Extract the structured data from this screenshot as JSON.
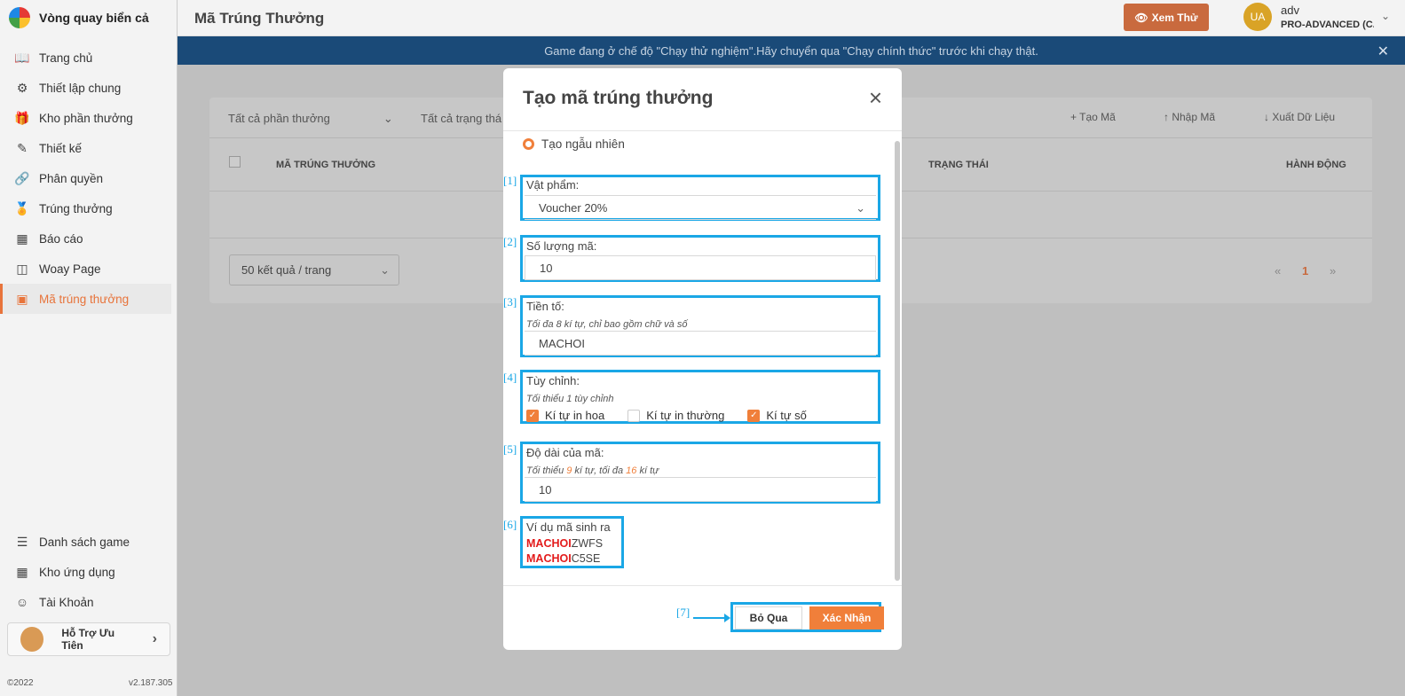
{
  "app": {
    "name": "Vòng quay biển cả"
  },
  "sidebar": {
    "items": [
      {
        "label": "Trang chủ",
        "icon": "book-icon"
      },
      {
        "label": "Thiết lập chung",
        "icon": "gear-icon"
      },
      {
        "label": "Kho phần thưởng",
        "icon": "gift-icon"
      },
      {
        "label": "Thiết kế",
        "icon": "edit-icon"
      },
      {
        "label": "Phân quyền",
        "icon": "link-icon"
      },
      {
        "label": "Trúng thưởng",
        "icon": "award-icon"
      },
      {
        "label": "Báo cáo",
        "icon": "grid-icon"
      },
      {
        "label": "Woay Page",
        "icon": "layout-icon"
      },
      {
        "label": "Mã trúng thưởng",
        "icon": "ticket-icon",
        "active": true
      }
    ],
    "bottom_items": [
      {
        "label": "Danh sách game",
        "icon": "menu-icon"
      },
      {
        "label": "Kho ứng dụng",
        "icon": "apps-icon"
      },
      {
        "label": "Tài Khoản",
        "icon": "user-icon"
      }
    ],
    "support": "Hỗ Trợ Ưu Tiên",
    "copyright": "©2022",
    "version": "v2.187.305"
  },
  "header": {
    "title": "Mã Trúng Thưởng",
    "preview_button": "Xem Thử",
    "user_initials": "UA",
    "user_name": "adv",
    "user_plan": "PRO-ADVANCED (C..."
  },
  "banner": {
    "text": "Game đang ở chế độ \"Chạy thử nghiệm\".Hãy chuyển qua \"Chạy chính thức\" trước khi chạy thật."
  },
  "table": {
    "filter_prize": "Tất cả phần thưởng",
    "filter_status": "Tất cả trạng thá",
    "create_code": "Tạo Mã",
    "import_code": "Nhập Mã",
    "export_data": "Xuất Dữ Liệu",
    "col_code": "MÃ TRÚNG THƯỞNG",
    "col_status": "TRẠNG THÁI",
    "col_action": "HÀNH ĐỘNG",
    "page_size": "50 kết quả / trang",
    "prev": "«",
    "current_page": "1",
    "next": "»"
  },
  "modal": {
    "title": "Tạo mã trúng thưởng",
    "mode_label": "Tạo ngẫu nhiên",
    "item_label": "Vật phẩm:",
    "item_value": "Voucher 20%",
    "quantity_label": "Số lượng mã:",
    "quantity_value": "10",
    "prefix_label": "Tiền tố:",
    "prefix_note": "Tối đa 8 kí tự, chỉ bao gồm chữ và số",
    "prefix_value": "MACHOI",
    "custom_label": "Tùy chỉnh:",
    "custom_note": "Tối thiểu 1 tùy chỉnh",
    "opt_upper": "Kí tự in hoa",
    "opt_lower": "Kí tự in thường",
    "opt_digit": "Kí tự số",
    "length_label": "Độ dài của mã:",
    "length_note_a": "Tối thiểu ",
    "length_min": "9",
    "length_note_b": " kí tự, tối đa ",
    "length_max": "16",
    "length_note_c": " kí tự",
    "length_value": "10",
    "sample_label": "Ví dụ mã sinh ra",
    "sample_prefix": "MACHOI",
    "sample_suffix_1": "ZWFS",
    "sample_suffix_2": "C5SE",
    "cancel": "Bỏ Qua",
    "confirm": "Xác Nhận"
  },
  "annotations": [
    "[1]",
    "[2]",
    "[3]",
    "[4]",
    "[5]",
    "[6]",
    "[7]"
  ],
  "colors": {
    "accent": "#f07f3a",
    "highlight": "#1aa7e6",
    "banner": "#1a4a78"
  }
}
